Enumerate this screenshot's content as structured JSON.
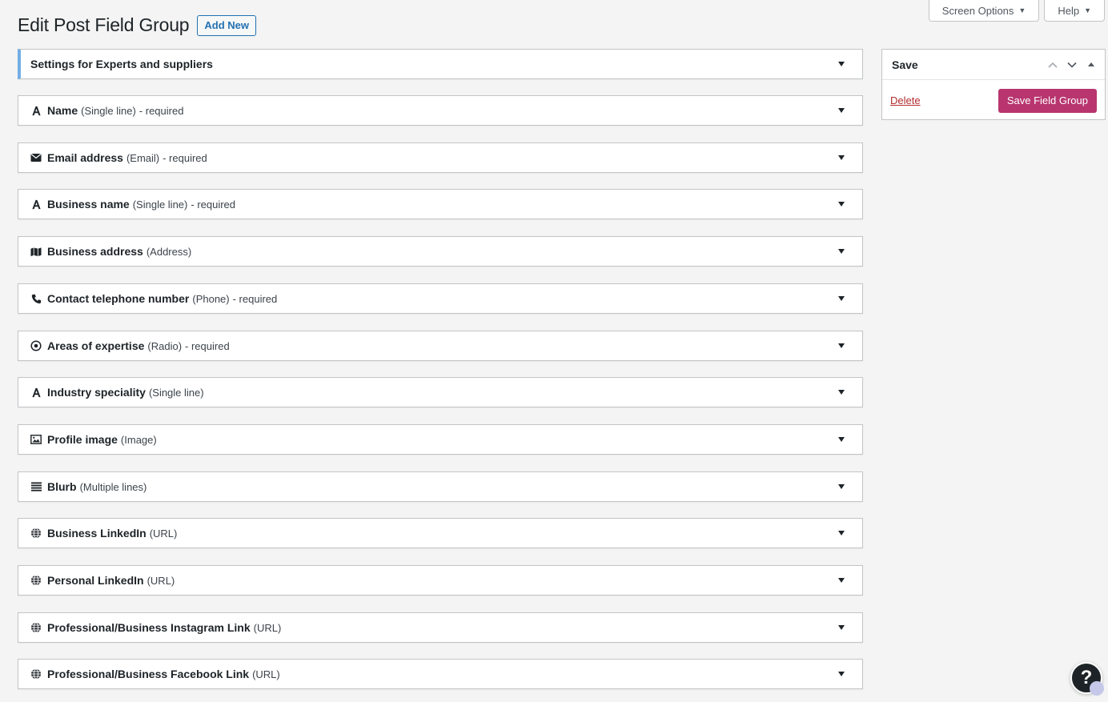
{
  "top_tabs": {
    "screen_options": "Screen Options",
    "help": "Help"
  },
  "header": {
    "title": "Edit Post Field Group",
    "add_new": "Add New"
  },
  "settings_panel": {
    "label": "Settings for Experts and suppliers"
  },
  "fields": [
    {
      "name": "Name",
      "type": "(Single line)",
      "required": "- required",
      "icon": "text-a-icon"
    },
    {
      "name": "Email address",
      "type": "(Email)",
      "required": "- required",
      "icon": "envelope-icon"
    },
    {
      "name": "Business name",
      "type": "(Single line)",
      "required": "- required",
      "icon": "text-a-icon"
    },
    {
      "name": "Business address",
      "type": "(Address)",
      "required": "",
      "icon": "map-icon"
    },
    {
      "name": "Contact telephone number",
      "type": "(Phone)",
      "required": "- required",
      "icon": "phone-icon"
    },
    {
      "name": "Areas of expertise",
      "type": "(Radio)",
      "required": "- required",
      "icon": "radio-icon"
    },
    {
      "name": "Industry speciality",
      "type": "(Single line)",
      "required": "",
      "icon": "text-a-icon"
    },
    {
      "name": "Profile image",
      "type": "(Image)",
      "required": "",
      "icon": "image-icon"
    },
    {
      "name": "Blurb",
      "type": "(Multiple lines)",
      "required": "",
      "icon": "lines-icon"
    },
    {
      "name": "Business LinkedIn",
      "type": "(URL)",
      "required": "",
      "icon": "globe-icon"
    },
    {
      "name": "Personal LinkedIn",
      "type": "(URL)",
      "required": "",
      "icon": "globe-icon"
    },
    {
      "name": "Professional/Business Instagram Link",
      "type": "(URL)",
      "required": "",
      "icon": "globe-icon"
    },
    {
      "name": "Professional/Business Facebook Link",
      "type": "(URL)",
      "required": "",
      "icon": "globe-icon"
    }
  ],
  "save_box": {
    "title": "Save",
    "delete": "Delete",
    "save_button": "Save Field Group"
  },
  "help_fab": "?",
  "colors": {
    "accent": "#2271b1",
    "save_button": "#b8356f",
    "delete_link": "#b32d2e",
    "settings_border": "#72aee6",
    "background": "#f3f4f3"
  }
}
